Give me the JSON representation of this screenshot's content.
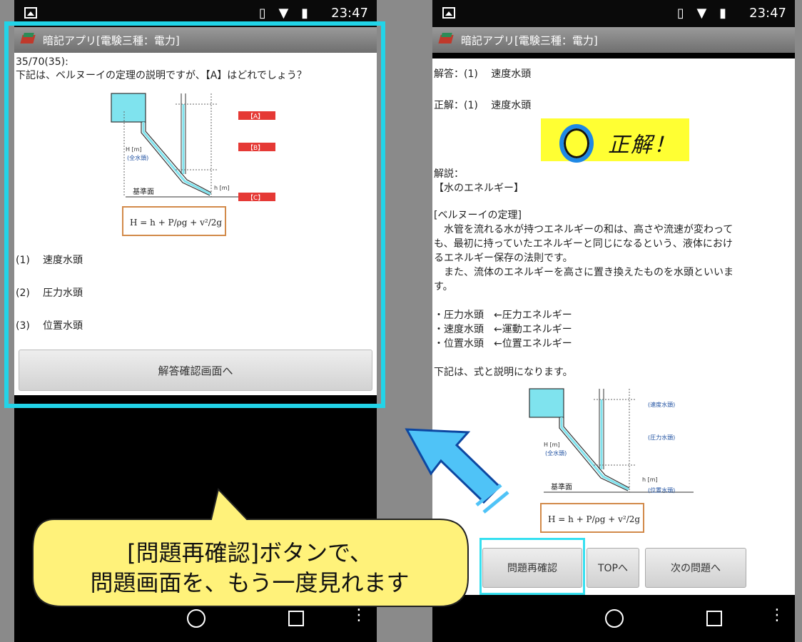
{
  "status_bar": {
    "time": "23:47"
  },
  "app": {
    "title": "暗記アプリ[電験三種：電力]"
  },
  "question_screen": {
    "progress": "35/70(35):",
    "question": "下記は、ベルヌーイの定理の説明ですが、【A】はどれでしょう？",
    "diagram_tags": [
      "【A】",
      "【B】",
      "【C】"
    ],
    "formula": "H = h + P/ρg + v²/2g",
    "choices": [
      {
        "num": "(1)",
        "label": "速度水頭"
      },
      {
        "num": "(2)",
        "label": "圧力水頭"
      },
      {
        "num": "(3)",
        "label": "位置水頭"
      }
    ],
    "answer_button": "解答確認画面へ"
  },
  "answer_screen": {
    "your_answer": "解答：(1)　 速度水頭",
    "correct_answer": "正解：(1)　 速度水頭",
    "correct_banner": "正解！",
    "explanation_label": "解説：",
    "section_water": "【水のエネルギー】",
    "section_bernoulli": "[ベルヌーイの定理]",
    "body_lines": [
      "　水管を流れる水が持つエネルギーの和は、高さや流速が変わって",
      "も、最初に持っていたエネルギーと同じになるという、液体におけ",
      "るエネルギー保存の法則です。",
      "　また、流体のエネルギーを高さに置き換えたものを水頭といいま",
      "す。"
    ],
    "bullets": [
      "・圧力水頭　←圧力エネルギー",
      "・速度水頭　←運動エネルギー",
      "・位置水頭　←位置エネルギー"
    ],
    "formula_intro": "下記は、式と説明になります。",
    "diagram_labels": [
      "(速度水頭)",
      "(圧力水頭)",
      "(位置水頭)"
    ],
    "buttons": {
      "recheck": "問題再確認",
      "top": "TOPへ",
      "next": "次の問題へ"
    }
  },
  "diagram": {
    "h_total": "H [m]",
    "total_head": "(全水頭)",
    "datum": "基準面",
    "h_label": "h [m]"
  },
  "callout": {
    "line1": "[問題再確認]ボタンで、",
    "line2": "問題画面を、もう一度見れます"
  },
  "colors": {
    "highlight": "#22d4e8",
    "tag_red": "#e53935",
    "callout_yellow": "#fff27a",
    "arrow_blue": "#4fc3f7"
  }
}
